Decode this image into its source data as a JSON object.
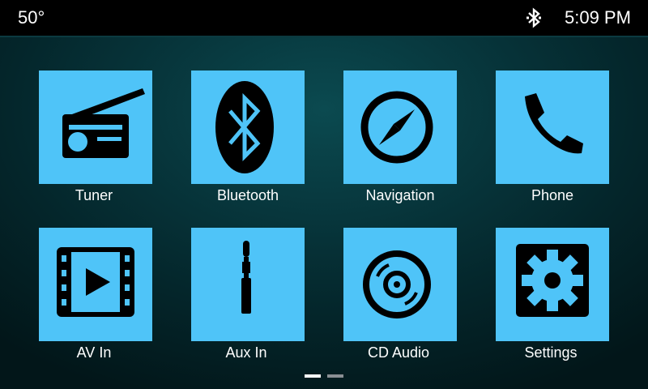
{
  "status_bar": {
    "temperature": "50°",
    "bluetooth_icon": "bluetooth-icon",
    "time": "5:09 PM"
  },
  "colors": {
    "tile": "#4fc4f8",
    "status_bar": "#000000",
    "icon": "#000000"
  },
  "apps": [
    {
      "label": "Tuner",
      "icon": "radio-icon"
    },
    {
      "label": "Bluetooth",
      "icon": "bluetooth-icon"
    },
    {
      "label": "Navigation",
      "icon": "compass-icon"
    },
    {
      "label": "Phone",
      "icon": "phone-icon"
    },
    {
      "label": "AV In",
      "icon": "video-play-icon"
    },
    {
      "label": "Aux In",
      "icon": "audio-jack-icon"
    },
    {
      "label": "CD Audio",
      "icon": "cd-icon"
    },
    {
      "label": "Settings",
      "icon": "gear-icon"
    }
  ],
  "pagination": {
    "pages": 2,
    "current": 1
  }
}
